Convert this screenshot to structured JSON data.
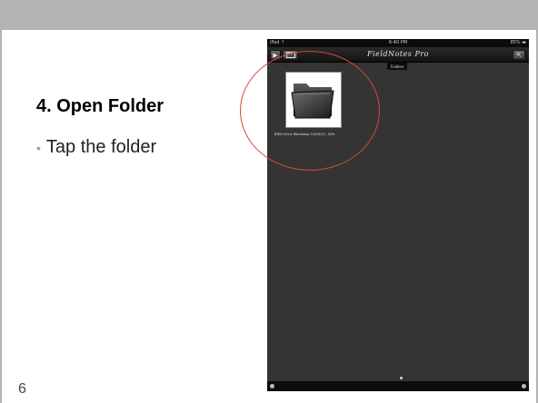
{
  "slide": {
    "title": "4. Open Folder",
    "bullet": "Tap the folder",
    "bullet_marker": "•",
    "page_number": "6"
  },
  "ipad": {
    "status_left": "iPad ⇡",
    "status_time": "6:40 PM",
    "status_right": "85% ▬",
    "app_title": "FieldNotes Pro",
    "section_label": "Folders",
    "folder_caption": "IDEN UCLA Workshop 15/03/15_ 5/5s",
    "play_glyph": "▶",
    "export_glyph": "⇱"
  },
  "colors": {
    "top_bar": "#b3b3b3",
    "circle": "#d04a3a",
    "ipad_bg": "#343434"
  }
}
